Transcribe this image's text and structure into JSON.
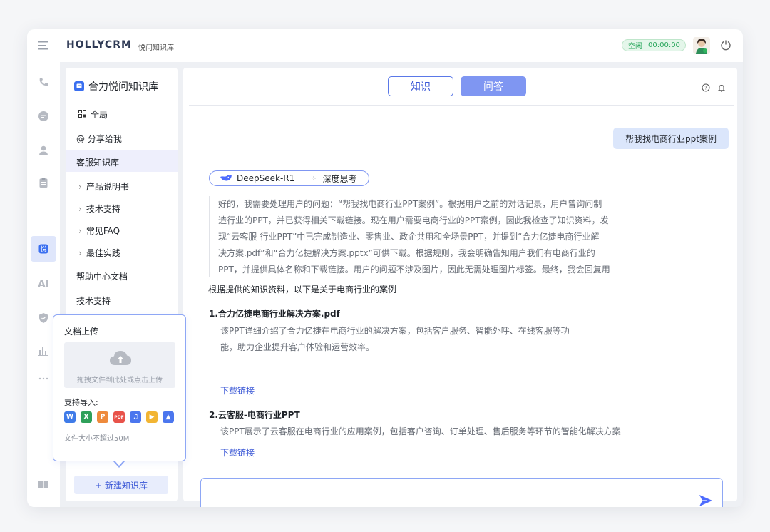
{
  "header": {
    "brand": "HOLLYCRM",
    "subtitle": "悦问知识库",
    "status_label": "空闲",
    "timer": "00:00:00"
  },
  "leftnav": {
    "ai_label": "AI",
    "items": [
      "phone-icon",
      "chat-icon",
      "contact-icon",
      "clipboard-icon",
      "knowledge-icon",
      "ai-icon",
      "shield-icon",
      "chart-icon",
      "more-icon",
      "book-icon",
      "bell-icon"
    ]
  },
  "kb_panel": {
    "title": "合力悦问知识库",
    "logo_text": "悦",
    "items": {
      "global": "全局",
      "shared": "@ 分享给我",
      "service_kb": "客服知识库",
      "sub1": "产品说明书",
      "sub2": "技术支持",
      "sub3": "常见FAQ",
      "sub4": "最佳实践",
      "help_docs": "帮助中心文档",
      "tech_support": "技术支持"
    },
    "new_button": "+ 新建知识库"
  },
  "upload": {
    "title": "文档上传",
    "drop_text": "拖拽文件到此处或点击上传",
    "support_label": "支持导入:",
    "file_types": [
      {
        "label": "W",
        "color": "#3f7be8"
      },
      {
        "label": "X",
        "color": "#2fa05a"
      },
      {
        "label": "P",
        "color": "#ee8a3c"
      },
      {
        "label": "PDF",
        "color": "#e8534a"
      },
      {
        "label": "♫",
        "color": "#4b76ee"
      },
      {
        "label": "▶",
        "color": "#f2b533"
      },
      {
        "label": "▲",
        "color": "#4b76ee"
      }
    ],
    "limit": "文件大小不超过50M"
  },
  "main": {
    "tabs": {
      "knowledge": "知识",
      "qa": "问答"
    },
    "user_message": "帮我找电商行业ppt案例",
    "model_name": "DeepSeek-R1",
    "deep_think": "深度思考",
    "thinking_lines": [
      "好的，我需要处理用户的问题：“帮我找电商行业PPT案例”。根据用户之前的对话记录，用户曾询问制",
      "造行业的PPT，并已获得相关下载链接。现在用户需要电商行业的PPT案例，因此我检查了知识资料，发",
      "现“云客服-行业PPT”中已完成制造业、零售业、政企共用和全场景PPT，并提到“合力亿捷电商行业解",
      "决方案.pdf”和“合力亿捷解决方案.pptx”可供下载。根据规则，我会明确告知用户我们有电商行业的",
      "PPT，并提供具体名称和下载链接。用户的问题不涉及图片，因此无需处理图片标签。最终，我会回复用"
    ],
    "answer_lead": "根据提供的知识资料，以下是关于电商行业的案例",
    "cases": [
      {
        "title": "1.合力亿捷电商行业解决方案.pdf",
        "desc_lines": [
          "该PPT详细介绍了合力亿捷在电商行业的解决方案，包括客户服务、智能外呼、在线客服等功",
          "能，助力企业提升客户体验和运营效率。"
        ],
        "link": "下载链接"
      },
      {
        "title": "2.云客服-电商行业PPT",
        "desc_lines": [
          "该PPT展示了云客服在电商行业的应用案例，包括客户咨询、订单处理、售后服务等环节的智能化解决方案"
        ],
        "link": "下载链接"
      }
    ]
  }
}
